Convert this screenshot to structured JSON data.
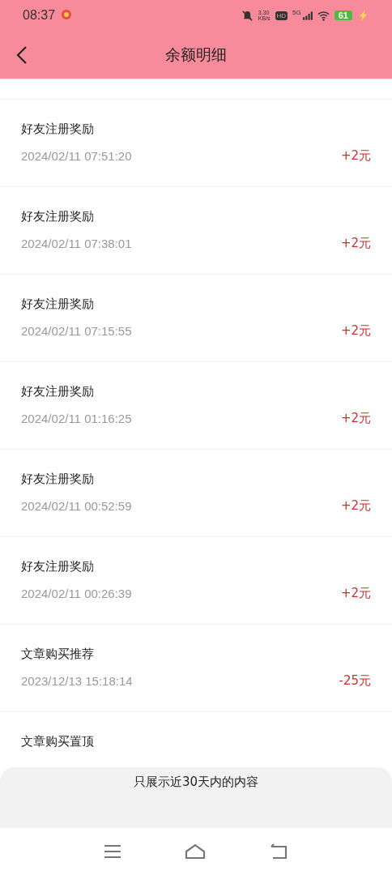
{
  "status_bar": {
    "time": "08:37",
    "net_speed": "3.30",
    "net_unit": "KB/s",
    "hd": "HD",
    "network": "5G",
    "battery": "61"
  },
  "header": {
    "title": "余额明细"
  },
  "records": [
    {
      "title": "好友注册奖励",
      "time": "2024/02/11 07:51:20",
      "amount": "+2元"
    },
    {
      "title": "好友注册奖励",
      "time": "2024/02/11 07:38:01",
      "amount": "+2元"
    },
    {
      "title": "好友注册奖励",
      "time": "2024/02/11 07:15:55",
      "amount": "+2元"
    },
    {
      "title": "好友注册奖励",
      "time": "2024/02/11 01:16:25",
      "amount": "+2元"
    },
    {
      "title": "好友注册奖励",
      "time": "2024/02/11 00:52:59",
      "amount": "+2元"
    },
    {
      "title": "好友注册奖励",
      "time": "2024/02/11 00:26:39",
      "amount": "+2元"
    },
    {
      "title": "文章购买推荐",
      "time": "2023/12/13 15:18:14",
      "amount": "-25元"
    },
    {
      "title": "文章购买置顶"
    }
  ],
  "toast": "只展示近30天内的内容"
}
